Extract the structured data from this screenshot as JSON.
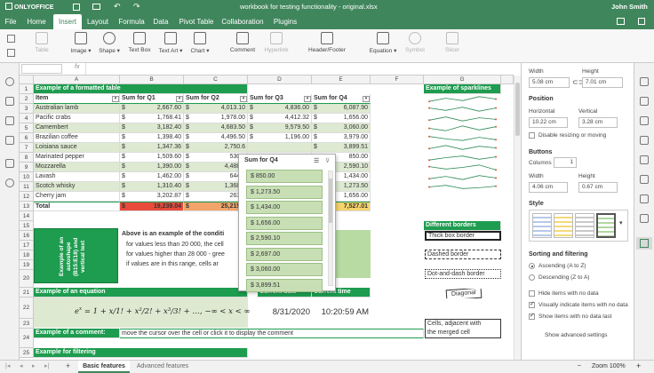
{
  "app": {
    "logo": "ONLYOFFICE",
    "title": "workbook for testing functionality - original.xlsx",
    "user": "John Smith"
  },
  "menu": {
    "tabs": [
      "File",
      "Home",
      "Insert",
      "Layout",
      "Formula",
      "Data",
      "Pivot Table",
      "Collaboration",
      "Plugins"
    ],
    "active": "Insert"
  },
  "toolbar": {
    "table": "Table",
    "image": "Image",
    "shape": "Shape",
    "textbox": "Text Box",
    "textart": "Text Art",
    "chart": "Chart",
    "comment": "Comment",
    "hyperlink": "Hyperlink",
    "headerfooter": "Header/Footer",
    "equation": "Equation",
    "symbol": "Symbol",
    "slicer": "Slicer"
  },
  "formulabar": {
    "fx": "fx",
    "value": ""
  },
  "columns": [
    "A",
    "B",
    "C",
    "D",
    "E",
    "F",
    "G"
  ],
  "rows": [
    "1",
    "2",
    "3",
    "4",
    "5",
    "6",
    "7",
    "8",
    "9",
    "10",
    "11",
    "12",
    "13",
    "14",
    "15",
    "16",
    "17",
    "18",
    "19",
    "20",
    "21",
    "22",
    "23",
    "24",
    "25"
  ],
  "table": {
    "title": "Example of a formatted table",
    "headers": [
      "Item",
      "Sum for Q1",
      "Sum for Q2",
      "Sum for Q3",
      "Sum for Q4"
    ],
    "rows": [
      [
        "Australian lamb",
        "$",
        "2,667.60",
        "$",
        "4,013.10",
        "$",
        "4,836.00",
        "$",
        "6,087.90"
      ],
      [
        "Pacific crabs",
        "$",
        "1,768.41",
        "$",
        "1,978.00",
        "$",
        "4,412.32",
        "$",
        "1,656.00"
      ],
      [
        "Camembert",
        "$",
        "3,182.40",
        "$",
        "4,683.50",
        "$",
        "9,579.50",
        "$",
        "3,060.00"
      ],
      [
        "Brazilian coffee",
        "$",
        "1,398.40",
        "$",
        "4,496.50",
        "$",
        "1,196.00",
        "$",
        "3,979.00"
      ],
      [
        "Loisiana sauce",
        "$",
        "1,347.36",
        "$",
        "2,750.6",
        "",
        "",
        "$",
        "3,899.51"
      ],
      [
        "Marinated pepper",
        "$",
        "1,509.60",
        "$",
        "530.4",
        "",
        "",
        "",
        "850.00"
      ],
      [
        "Mozzarella",
        "$",
        "1,390.00",
        "$",
        "4,488.2",
        "",
        "",
        "",
        "2,590.10"
      ],
      [
        "Lavash",
        "$",
        "1,462.00",
        "$",
        "644.0",
        "",
        "",
        "",
        "1,434.00"
      ],
      [
        "Scotch whisky",
        "$",
        "1,310.40",
        "$",
        "1,368.0",
        "",
        "",
        "",
        "1,273.50"
      ],
      [
        "Cherry jam",
        "$",
        "3,202.87",
        "$",
        "263.4",
        "",
        "",
        "",
        "1,656.00"
      ]
    ],
    "total": [
      "Total",
      "$",
      "19,239.04",
      "$",
      "25,215.7",
      "",
      "",
      "",
      "7,527.01"
    ]
  },
  "autoshape": {
    "text": "Example of an autoshape (B15:E18) and vertical text"
  },
  "condition": {
    "title": "Above is an example of the conditi",
    "l1": "for values less than 20 000, the cell",
    "l2": "for values higher than 28 000 - gree",
    "l3": "if values are in this range, cells ar"
  },
  "equation": {
    "title": "Example of an equation",
    "current_date_lbl": "Current date",
    "current_time_lbl": "Current time",
    "date": "8/31/2020",
    "time": "10:20:59 AM"
  },
  "comment": {
    "title": "Example of a comment:",
    "text": "move the cursor over the cell or click it to display the comment"
  },
  "filtering": {
    "title": "Example for filtering"
  },
  "sparklines": {
    "title": "Example of sparklines"
  },
  "borders": {
    "title": "Different borders",
    "thick": "Thick box border",
    "dashed": "Dashed border",
    "dotdash": "Dot-and-dash border",
    "diagonal": "Diagonal",
    "merged1": "Cells, adjacent with",
    "merged2": "the merged cell"
  },
  "filter_popup": {
    "title": "Sum for Q4",
    "items": [
      "$ 850.00",
      "$ 1,273.50",
      "$ 1,434.00",
      "$ 1,656.00",
      "$ 2,590.10",
      "$ 2,697.00",
      "$ 3,060.00",
      "$ 3,899.51"
    ]
  },
  "rightpanel": {
    "width_lbl": "Width",
    "height_lbl": "Height",
    "width": "5.08 cm",
    "height": "7.01 cm",
    "position": "Position",
    "horizontal_lbl": "Horizontal",
    "vertical_lbl": "Vertical",
    "horizontal": "10.22 cm",
    "vertical": "3.28 cm",
    "disable_resize": "Disable resizing or moving",
    "buttons": "Buttons",
    "columns_lbl": "Columns",
    "columns_val": "1",
    "bwidth_lbl": "Width",
    "bheight_lbl": "Height",
    "bwidth": "4.06 cm",
    "bheight": "0.67 cm",
    "style": "Style",
    "sorting": "Sorting and filtering",
    "asc": "Ascending (A to Z)",
    "desc": "Descending (Z to A)",
    "hide_nodata": "Hide items with no data",
    "vis_nodata": "Visually indicate items with no data",
    "show_last": "Show items with no data last",
    "advanced": "Show advanced settings"
  },
  "status": {
    "sheets": [
      "Basic features",
      "Advanced features"
    ],
    "active": "Basic features",
    "zoom": "Zoom 100%"
  },
  "colors": {
    "brand": "#40865c",
    "table_header": "#1e9c4f",
    "band": "#dde9d1",
    "red": "#e84b3c",
    "orange": "#f3a46b",
    "yellow": "#f6d36b"
  }
}
